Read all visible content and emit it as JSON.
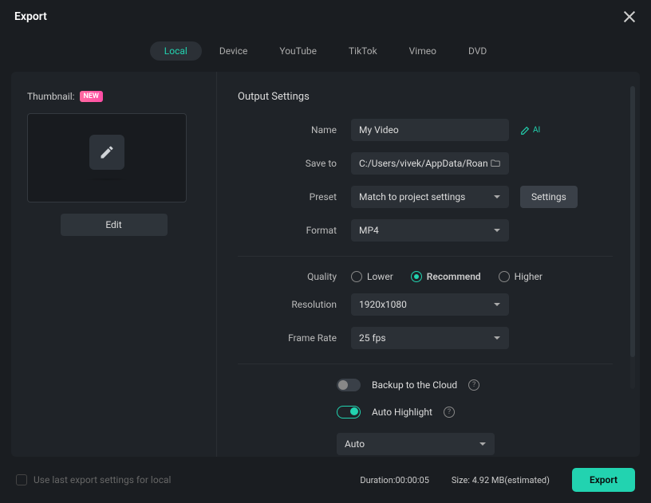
{
  "header": {
    "title": "Export"
  },
  "tabs": [
    "Local",
    "Device",
    "YouTube",
    "TikTok",
    "Vimeo",
    "DVD"
  ],
  "active_tab": "Local",
  "thumbnail": {
    "label": "Thumbnail:",
    "badge": "NEW",
    "edit_label": "Edit"
  },
  "output": {
    "section_title": "Output Settings",
    "name_label": "Name",
    "name_value": "My Video",
    "ai_label": "AI",
    "saveto_label": "Save to",
    "saveto_value": "C:/Users/vivek/AppData/Roan",
    "preset_label": "Preset",
    "preset_value": "Match to project settings",
    "settings_label": "Settings",
    "format_label": "Format",
    "format_value": "MP4",
    "quality_label": "Quality",
    "quality_options": [
      "Lower",
      "Recommend",
      "Higher"
    ],
    "quality_selected": "Recommend",
    "resolution_label": "Resolution",
    "resolution_value": "1920x1080",
    "framerate_label": "Frame Rate",
    "framerate_value": "25 fps",
    "backup_label": "Backup to the Cloud",
    "highlight_label": "Auto Highlight",
    "highlight_mode": "Auto"
  },
  "footer": {
    "checkbox_label": "Use last export settings for local",
    "duration_label": "Duration:",
    "duration_value": "00:00:05",
    "size_label": "Size:",
    "size_value": "4.92 MB(estimated)",
    "export_label": "Export"
  }
}
